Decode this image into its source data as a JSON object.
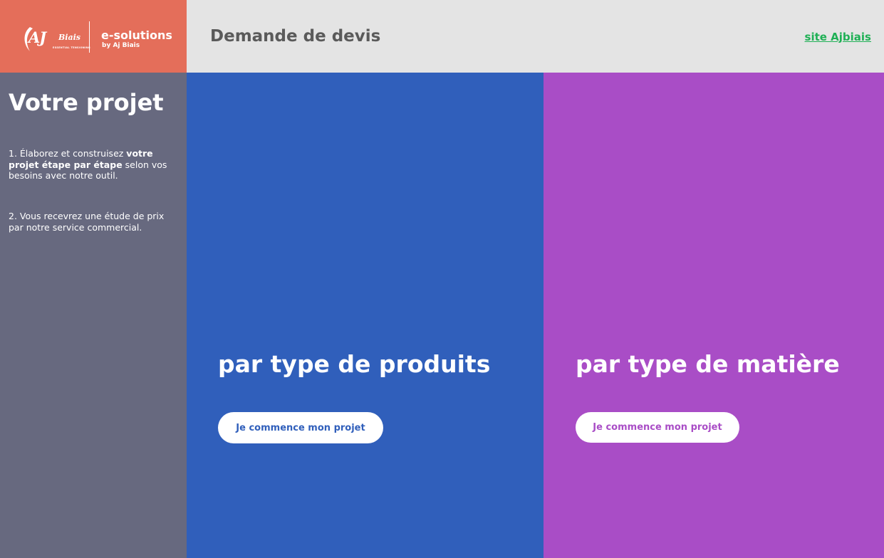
{
  "brand": {
    "logo_text": "AJ",
    "logo_biais": "Biais",
    "logo_tagline": "ESSENTIAL TENSIONING",
    "product_name": "e-solutions",
    "product_by": "by Aj Biais",
    "color": "#e46e5a"
  },
  "header": {
    "title": "Demande de devis",
    "site_link": "site Ajbiais",
    "link_color": "#1fb055"
  },
  "sidebar": {
    "heading": "Votre projet",
    "step1": {
      "prefix": "1. Élaborez et construisez ",
      "bold1": "votre projet étape par étape",
      "suffix": " selon vos besoins avec notre outil."
    },
    "step2": "2. Vous recevrez une étude de prix par notre service commercial."
  },
  "panels": [
    {
      "title": "par type de produits",
      "button": "Je commence mon projet",
      "color": "#305fbb"
    },
    {
      "title": "par type de matière",
      "button": "Je commence mon projet",
      "color": "#a94dc6"
    }
  ]
}
